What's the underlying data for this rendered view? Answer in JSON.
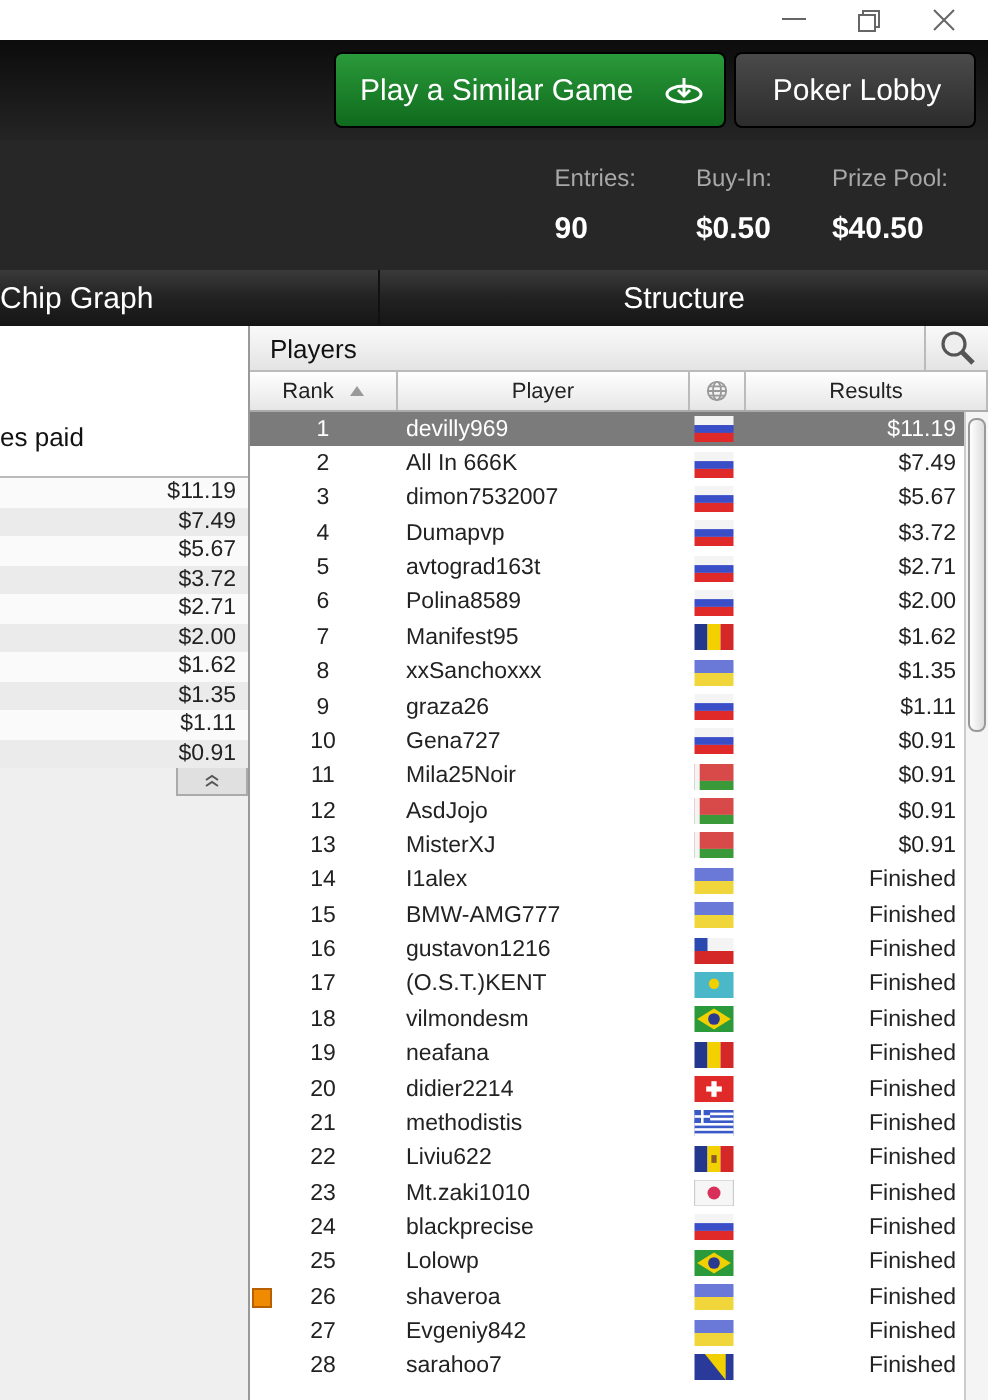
{
  "header": {
    "buttons": [
      {
        "label": "Play a Similar Game",
        "kind": "play"
      },
      {
        "label": "Poker Lobby",
        "kind": "plain"
      }
    ]
  },
  "stats": [
    {
      "label": "Entries:",
      "value": "90"
    },
    {
      "label": "Buy-In:",
      "value": "$0.50"
    },
    {
      "label": "Prize Pool:",
      "value": "$40.50"
    }
  ],
  "tabs": [
    {
      "label": "Chip Graph",
      "selected": false
    },
    {
      "label": "Structure",
      "selected": false
    }
  ],
  "payouts": {
    "heading": "es paid",
    "amounts": [
      "$11.19",
      "$7.49",
      "$5.67",
      "$3.72",
      "$2.71",
      "$2.00",
      "$1.62",
      "$1.35",
      "$1.11",
      "$0.91"
    ]
  },
  "players": {
    "title": "Players",
    "columns": [
      "Rank",
      "Player",
      "Results"
    ],
    "rows": [
      {
        "rank": "1",
        "player": "devilly969",
        "kind": "ru",
        "result": "$11.19",
        "selected": true,
        "marked": false
      },
      {
        "rank": "2",
        "player": "All In 666K",
        "kind": "ru",
        "result": "$7.49",
        "selected": false,
        "marked": false
      },
      {
        "rank": "3",
        "player": "dimon7532007",
        "kind": "ru",
        "result": "$5.67",
        "selected": false,
        "marked": false
      },
      {
        "rank": "4",
        "player": "Dumapvp",
        "kind": "ru",
        "result": "$3.72",
        "selected": false,
        "marked": false
      },
      {
        "rank": "5",
        "player": "avtograd163t",
        "kind": "ru",
        "result": "$2.71",
        "selected": false,
        "marked": false
      },
      {
        "rank": "6",
        "player": "Polina8589",
        "kind": "ru",
        "result": "$2.00",
        "selected": false,
        "marked": false
      },
      {
        "rank": "7",
        "player": "Manifest95",
        "kind": "ro",
        "result": "$1.62",
        "selected": false,
        "marked": false
      },
      {
        "rank": "8",
        "player": "xxSanchoxxx",
        "kind": "ua",
        "result": "$1.35",
        "selected": false,
        "marked": false
      },
      {
        "rank": "9",
        "player": "graza26",
        "kind": "ru",
        "result": "$1.11",
        "selected": false,
        "marked": false
      },
      {
        "rank": "10",
        "player": "Gena727",
        "kind": "ru",
        "result": "$0.91",
        "selected": false,
        "marked": false
      },
      {
        "rank": "11",
        "player": "Mila25Noir",
        "kind": "by",
        "result": "$0.91",
        "selected": false,
        "marked": false
      },
      {
        "rank": "12",
        "player": "AsdJojo",
        "kind": "by",
        "result": "$0.91",
        "selected": false,
        "marked": false
      },
      {
        "rank": "13",
        "player": "MisterXJ",
        "kind": "by",
        "result": "$0.91",
        "selected": false,
        "marked": false
      },
      {
        "rank": "14",
        "player": "I1alex",
        "kind": "ua",
        "result": "Finished",
        "selected": false,
        "marked": false
      },
      {
        "rank": "15",
        "player": "BMW-AMG777",
        "kind": "ua",
        "result": "Finished",
        "selected": false,
        "marked": false
      },
      {
        "rank": "16",
        "player": "gustavon1216",
        "kind": "cl",
        "result": "Finished",
        "selected": false,
        "marked": false
      },
      {
        "rank": "17",
        "player": "(O.S.T.)KENT",
        "kind": "kz",
        "result": "Finished",
        "selected": false,
        "marked": false
      },
      {
        "rank": "18",
        "player": "vilmondesm",
        "kind": "br",
        "result": "Finished",
        "selected": false,
        "marked": false
      },
      {
        "rank": "19",
        "player": "neafana",
        "kind": "ro",
        "result": "Finished",
        "selected": false,
        "marked": false
      },
      {
        "rank": "20",
        "player": "didier2214",
        "kind": "ch",
        "result": "Finished",
        "selected": false,
        "marked": false
      },
      {
        "rank": "21",
        "player": "methodistis",
        "kind": "gr",
        "result": "Finished",
        "selected": false,
        "marked": false
      },
      {
        "rank": "22",
        "player": "Liviu622",
        "kind": "md",
        "result": "Finished",
        "selected": false,
        "marked": false
      },
      {
        "rank": "23",
        "player": "Mt.zaki1010",
        "kind": "jp",
        "result": "Finished",
        "selected": false,
        "marked": false
      },
      {
        "rank": "24",
        "player": "blackprecise",
        "kind": "ru",
        "result": "Finished",
        "selected": false,
        "marked": false
      },
      {
        "rank": "25",
        "player": "Lolowp",
        "kind": "br",
        "result": "Finished",
        "selected": false,
        "marked": false
      },
      {
        "rank": "26",
        "player": "shaveroa",
        "kind": "ua",
        "result": "Finished",
        "selected": false,
        "marked": true
      },
      {
        "rank": "27",
        "player": "Evgeniy842",
        "kind": "ua",
        "result": "Finished",
        "selected": false,
        "marked": false
      },
      {
        "rank": "28",
        "player": "sarahoo7",
        "kind": "ba",
        "result": "Finished",
        "selected": false,
        "marked": false
      }
    ]
  }
}
